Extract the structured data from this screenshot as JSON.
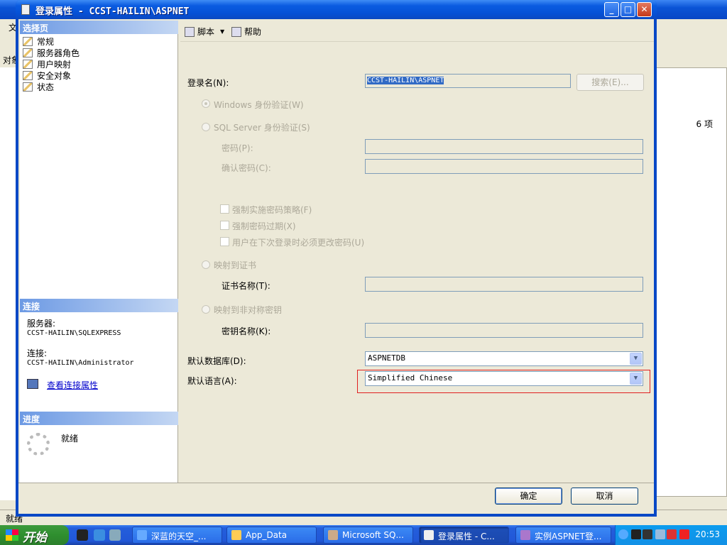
{
  "background_app": {
    "menu_first": "文",
    "object_explorer_label": "对象",
    "item_count": "6 项",
    "status": "就绪"
  },
  "dialog": {
    "title": "登录属性 - CCST-HAILIN\\ASPNET",
    "select_page_header": "选择页",
    "pages": [
      "常规",
      "服务器角色",
      "用户映射",
      "安全对象",
      "状态"
    ],
    "connection_header": "连接",
    "server_label": "服务器:",
    "server_value": "CCST-HAILIN\\SQLEXPRESS",
    "connection_label": "连接:",
    "connection_value": "CCST-HAILIN\\Administrator",
    "view_connection_properties": "查看连接属性",
    "progress_header": "进度",
    "progress_status": "就绪",
    "toolbar": {
      "script": "脚本",
      "help": "帮助"
    },
    "form": {
      "login_name_label": "登录名(N):",
      "login_name_value": "CCST-HAILIN\\ASPNET",
      "search_button": "搜索(E)...",
      "windows_auth": "Windows 身份验证(W)",
      "sql_auth": "SQL Server 身份验证(S)",
      "password_label": "密码(P):",
      "confirm_password_label": "确认密码(C):",
      "enforce_policy": "强制实施密码策略(F)",
      "enforce_expiration": "强制密码过期(X)",
      "must_change": "用户在下次登录时必须更改密码(U)",
      "map_cert": "映射到证书",
      "cert_name_label": "证书名称(T):",
      "map_asym_key": "映射到非对称密钥",
      "key_name_label": "密钥名称(K):",
      "default_db_label": "默认数据库(D):",
      "default_db_value": "ASPNETDB",
      "default_lang_label": "默认语言(A):",
      "default_lang_value": "Simplified Chinese"
    },
    "ok_button": "确定",
    "cancel_button": "取消"
  },
  "taskbar": {
    "start": "开始",
    "tasks": [
      "深蓝的天空_...",
      "App_Data",
      "Microsoft SQ...",
      "登录属性 - C...",
      "实例ASPNET登..."
    ],
    "clock": "20:53"
  }
}
